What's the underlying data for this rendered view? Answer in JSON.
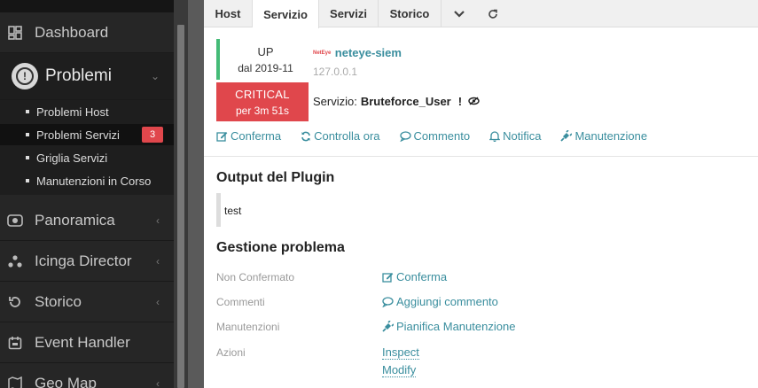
{
  "sidebar": {
    "items": [
      {
        "label": "Dashboard",
        "icon": "dashboard-icon"
      },
      {
        "label": "Problemi",
        "icon": "problems-icon"
      },
      {
        "label": "Panoramica",
        "icon": "overview-icon"
      },
      {
        "label": "Icinga Director",
        "icon": "director-icon"
      },
      {
        "label": "Storico",
        "icon": "history-icon"
      },
      {
        "label": "Event Handler",
        "icon": "event-handler-icon"
      },
      {
        "label": "Geo Map",
        "icon": "map-icon"
      }
    ],
    "subitems": [
      {
        "label": "Problemi Host"
      },
      {
        "label": "Problemi Servizi",
        "badge": "3"
      },
      {
        "label": "Griglia Servizi"
      },
      {
        "label": "Manutenzioni in Corso"
      }
    ]
  },
  "tabs": [
    {
      "label": "Host"
    },
    {
      "label": "Servizio"
    },
    {
      "label": "Servizi"
    },
    {
      "label": "Storico"
    }
  ],
  "host": {
    "state": "UP",
    "since": "dal 2019-11",
    "logo": "NetEye",
    "name": "neteye-siem",
    "ip": "127.0.0.1"
  },
  "service": {
    "state": "CRITICAL",
    "duration": "per 3m 51s",
    "prefix": "Servizio:",
    "name": "Bruteforce_User",
    "mark": "!"
  },
  "actions": [
    {
      "label": "Conferma",
      "icon": "edit-icon"
    },
    {
      "label": "Controlla ora",
      "icon": "refresh-icon"
    },
    {
      "label": "Commento",
      "icon": "comment-icon"
    },
    {
      "label": "Notifica",
      "icon": "bell-icon"
    },
    {
      "label": "Manutenzione",
      "icon": "plug-icon"
    }
  ],
  "plugin": {
    "title": "Output del Plugin",
    "output": "test"
  },
  "problem": {
    "title": "Gestione problema",
    "rows": [
      {
        "label": "Non Confermato",
        "link": "Conferma",
        "icon": "edit-icon"
      },
      {
        "label": "Commenti",
        "link": "Aggiungi commento",
        "icon": "comment-icon"
      },
      {
        "label": "Manutenzioni",
        "link": "Pianifica Manutenzione",
        "icon": "plug-icon"
      },
      {
        "label": "Azioni",
        "links": [
          "Inspect",
          "Modify"
        ]
      }
    ]
  },
  "colors": {
    "sidebar_bg": "#262626",
    "ok": "#44bb77",
    "critical": "#e0474c",
    "link": "#3a8e9e"
  }
}
